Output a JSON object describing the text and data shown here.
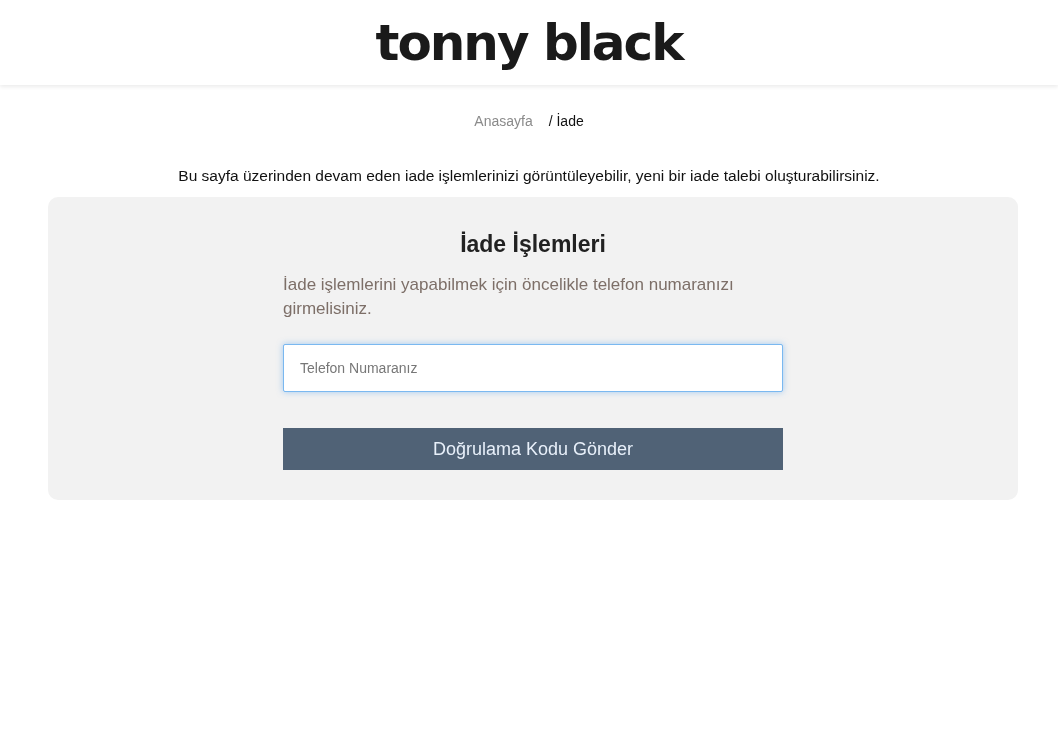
{
  "header": {
    "logo": "tonny black"
  },
  "breadcrumb": {
    "separator": "/",
    "items": [
      {
        "label": "Anasayfa",
        "selected": false
      },
      {
        "label": "İade",
        "selected": true
      }
    ]
  },
  "intro": "Bu sayfa üzerinden devam eden iade işlemlerinizi görüntüleyebilir, yeni bir iade talebi oluşturabilirsiniz.",
  "panel": {
    "title": "İade İşlemleri",
    "description": "İade işlemlerini yapabilmek için öncelikle telefon numaranızı girmelisiniz.",
    "phone_field": {
      "placeholder": "Telefon Numaranız",
      "focused": true
    },
    "submit_button": "Doğrulama Kodu Gönder"
  }
}
